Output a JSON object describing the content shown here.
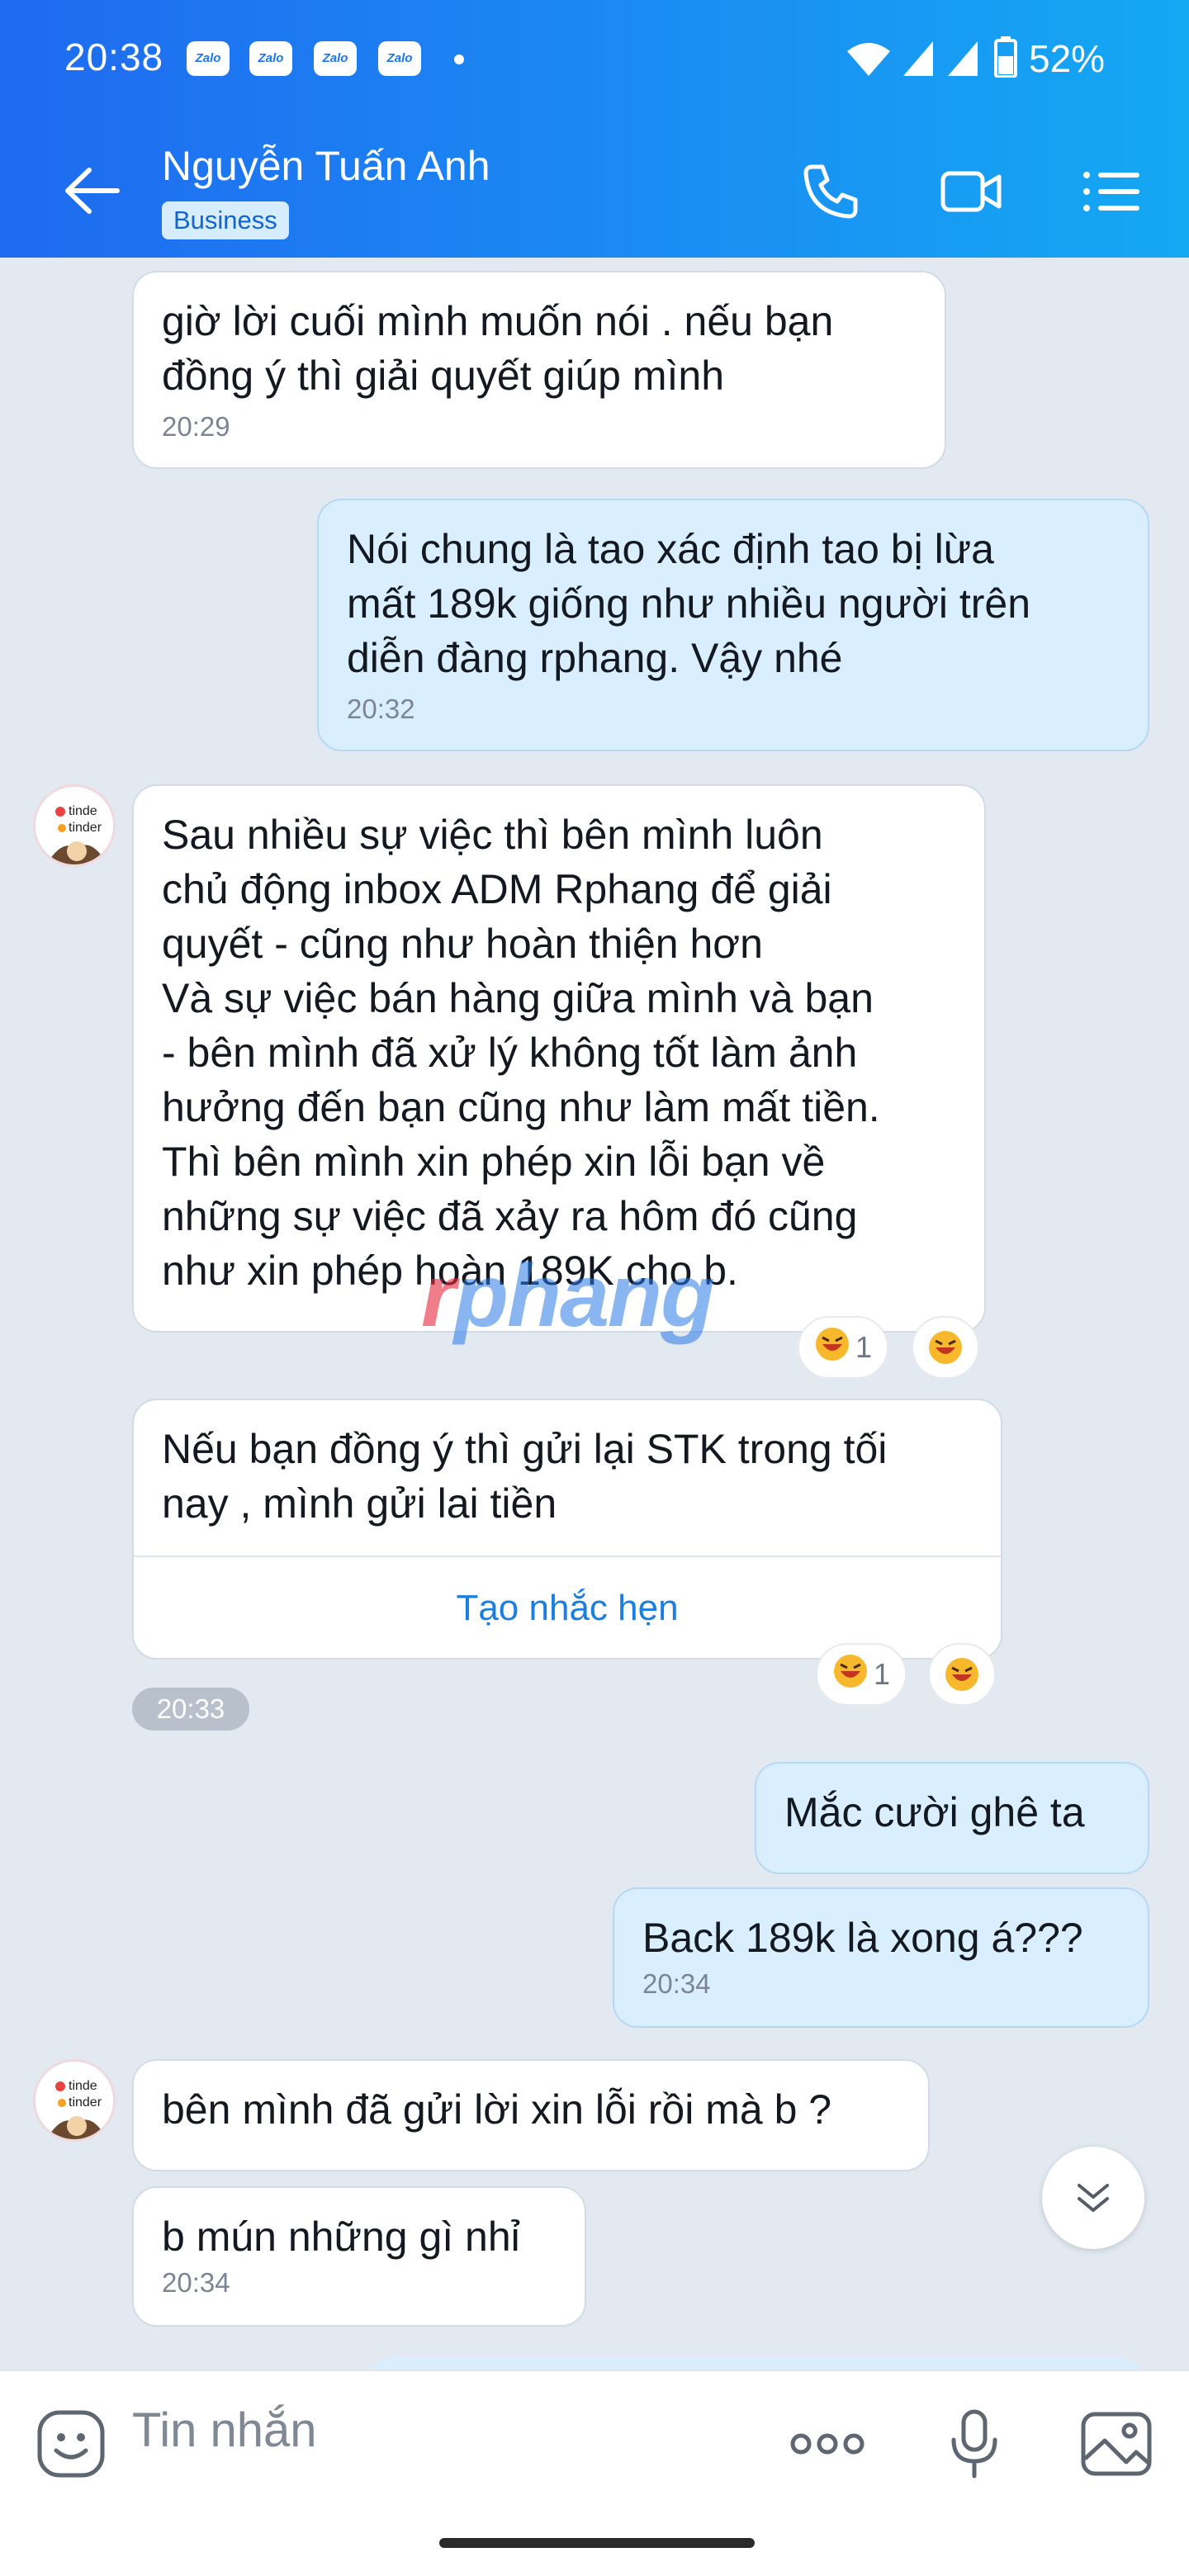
{
  "status_bar": {
    "time": "20:38",
    "notif_label": "Zalo",
    "battery": "52%"
  },
  "header": {
    "contact_name": "Nguyễn Tuấn Anh",
    "badge": "Business"
  },
  "messages": [
    {
      "text": "giờ lời cuối mình muốn nói . nếu bạn\nđồng ý thì giải quyết giúp mình",
      "time": "20:29",
      "direction": "in"
    },
    {
      "text": "Nói chung là tao xác định tao bị lừa\nmất 189k giống như nhiều người trên\ndiễn đàng rphang. Vậy nhé",
      "time": "20:32",
      "direction": "out"
    },
    {
      "text": "Sau nhiều sự việc thì bên mình luôn\nchủ động inbox ADM Rphang để giải\nquyết - cũng như hoàn thiện hơn\nVà sự việc bán hàng giữa mình và bạn\n- bên mình đã xử lý không tốt làm ảnh\nhưởng đến bạn cũng như làm mất tiền.\nThì bên mình xin phép xin lỗi bạn về\nnhững sự việc đã xảy ra hôm đó cũng\nnhư xin phép hoàn 189K cho b.",
      "direction": "in",
      "reaction_count": "1"
    },
    {
      "text": "Nếu bạn đồng ý thì gửi lại STK trong tối\nnay , mình gửi lai tiền",
      "action": "Tạo nhắc hẹn",
      "direction": "in",
      "reaction_count": "1"
    },
    {
      "text": "Mắc cười ghê ta",
      "direction": "out"
    },
    {
      "text": "Back 189k là xong á???",
      "time": "20:34",
      "direction": "out"
    },
    {
      "text": "bên mình đã gửi lời xin lỗi rồi mà b ?",
      "direction": "in"
    },
    {
      "text": "b mún những gì nhỉ",
      "time": "20:34",
      "direction": "in"
    }
  ],
  "time_pill": "20:33",
  "watermark": {
    "r": "r",
    "rest": "phang"
  },
  "avatar_text": {
    "line1": "tinde",
    "line2": "tinder"
  },
  "input": {
    "placeholder": "Tin nhắn"
  },
  "colors": {
    "header_start": "#1f6af0",
    "header_end": "#14a8f3",
    "outgoing_bubble": "#d9efff",
    "background": "#e2e9f1"
  },
  "icons": [
    "back-arrow-icon",
    "phone-icon",
    "video-call-icon",
    "menu-icon",
    "emoji-icon",
    "more-icon",
    "voice-icon",
    "image-icon",
    "scroll-down-icon",
    "laugh-reaction-icon"
  ]
}
